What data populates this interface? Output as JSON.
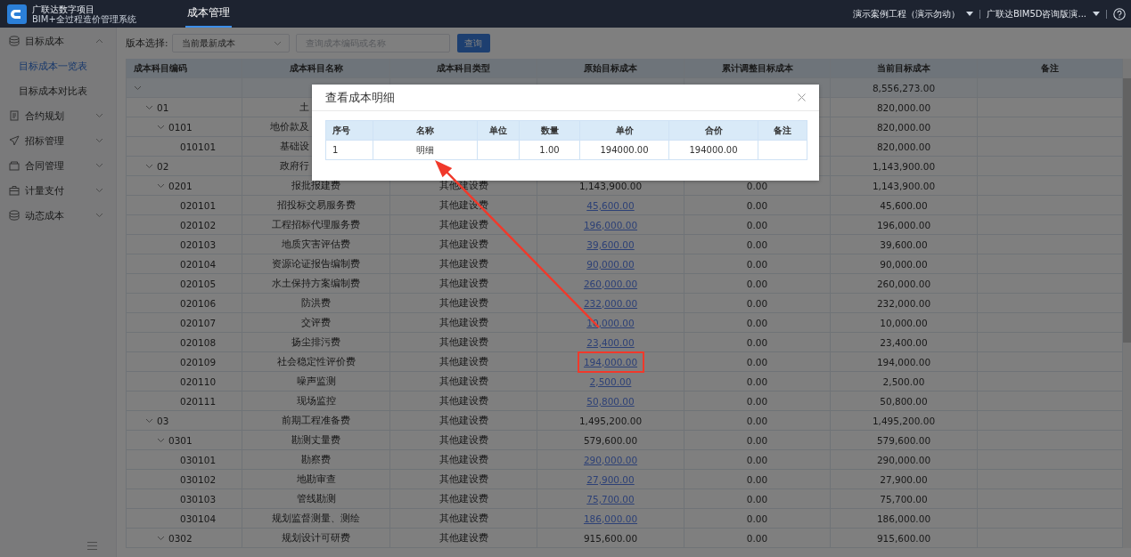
{
  "header": {
    "logo_title": "广联达数字项目",
    "logo_subtitle": "BIM+全过程造价管理系统",
    "tabs": [
      {
        "label": "成本管理",
        "selected": true
      }
    ],
    "project": "演示案例工程（演示勿动）",
    "account": "广联达BIM5D咨询版演..."
  },
  "sidebar": {
    "items": [
      {
        "label": "目标成本",
        "expanded": true,
        "children": [
          {
            "label": "目标成本一览表",
            "selected": true
          },
          {
            "label": "目标成本对比表",
            "selected": false
          }
        ]
      },
      {
        "label": "合约规划",
        "expanded": false
      },
      {
        "label": "招标管理",
        "expanded": false
      },
      {
        "label": "合同管理",
        "expanded": false
      },
      {
        "label": "计量支付",
        "expanded": false
      },
      {
        "label": "动态成本",
        "expanded": false
      }
    ]
  },
  "toolbar": {
    "version_label": "版本选择:",
    "version_value": "当前最新成本",
    "search_placeholder": "查询成本编码或名称",
    "query_button": "查询"
  },
  "table": {
    "columns": [
      "成本科目编码",
      "成本科目名称",
      "成本科目类型",
      "原始目标成本",
      "累计调整目标成本",
      "当前目标成本",
      "备注"
    ],
    "rows": [
      {
        "expanded": true,
        "current": "8,556,273.00",
        "children": [
          {
            "code": "01",
            "expanded": true,
            "name": "土",
            "current": "820,000.00",
            "children": [
              {
                "code": "0101",
                "expanded": true,
                "name": "地价款及",
                "current": "820,000.00",
                "children": [
                  {
                    "code": "010101",
                    "name": "基础设",
                    "current": "820,000.00"
                  }
                ]
              }
            ]
          },
          {
            "code": "02",
            "expanded": true,
            "name": "政府行",
            "current": "1,143,900.00",
            "children": [
              {
                "code": "0201",
                "expanded": true,
                "name": "报批报建费",
                "type": "其他建设费",
                "original": "1,143,900.00",
                "cumulative": "0.00",
                "current": "1,143,900.00",
                "children": [
                  {
                    "code": "020101",
                    "name": "招投标交易服务费",
                    "type": "其他建设费",
                    "original": "45,600.00",
                    "cumulative": "0.00",
                    "current": "45,600.00"
                  },
                  {
                    "code": "020102",
                    "name": "工程招标代理服务费",
                    "type": "其他建设费",
                    "original": "196,000.00",
                    "cumulative": "0.00",
                    "current": "196,000.00"
                  },
                  {
                    "code": "020103",
                    "name": "地质灾害评估费",
                    "type": "其他建设费",
                    "original": "39,600.00",
                    "cumulative": "0.00",
                    "current": "39,600.00"
                  },
                  {
                    "code": "020104",
                    "name": "资源论证报告编制费",
                    "type": "其他建设费",
                    "original": "90,000.00",
                    "cumulative": "0.00",
                    "current": "90,000.00"
                  },
                  {
                    "code": "020105",
                    "name": "水土保持方案编制费",
                    "type": "其他建设费",
                    "original": "260,000.00",
                    "cumulative": "0.00",
                    "current": "260,000.00"
                  },
                  {
                    "code": "020106",
                    "name": "防洪费",
                    "type": "其他建设费",
                    "original": "232,000.00",
                    "cumulative": "0.00",
                    "current": "232,000.00"
                  },
                  {
                    "code": "020107",
                    "name": "交评费",
                    "type": "其他建设费",
                    "original": "10,000.00",
                    "cumulative": "0.00",
                    "current": "10,000.00"
                  },
                  {
                    "code": "020108",
                    "name": "扬尘排污费",
                    "type": "其他建设费",
                    "original": "23,400.00",
                    "cumulative": "0.00",
                    "current": "23,400.00"
                  },
                  {
                    "code": "020109",
                    "name": "社会稳定性评价费",
                    "type": "其他建设费",
                    "original": "194,000.00",
                    "cumulative": "0.00",
                    "current": "194,000.00",
                    "highlighted": true
                  },
                  {
                    "code": "020110",
                    "name": "噪声监测",
                    "type": "其他建设费",
                    "original": "2,500.00",
                    "cumulative": "0.00",
                    "current": "2,500.00"
                  },
                  {
                    "code": "020111",
                    "name": "现场监控",
                    "type": "其他建设费",
                    "original": "50,800.00",
                    "cumulative": "0.00",
                    "current": "50,800.00"
                  }
                ]
              }
            ]
          },
          {
            "code": "03",
            "expanded": true,
            "name": "前期工程准备费",
            "type": "其他建设费",
            "original": "1,495,200.00",
            "cumulative": "0.00",
            "current": "1,495,200.00",
            "children": [
              {
                "code": "0301",
                "expanded": true,
                "name": "勘测丈量费",
                "type": "其他建设费",
                "original": "579,600.00",
                "cumulative": "0.00",
                "current": "579,600.00",
                "children": [
                  {
                    "code": "030101",
                    "name": "勘察费",
                    "type": "其他建设费",
                    "original": "290,000.00",
                    "cumulative": "0.00",
                    "current": "290,000.00"
                  },
                  {
                    "code": "030102",
                    "name": "地勘审查",
                    "type": "其他建设费",
                    "original": "27,900.00",
                    "cumulative": "0.00",
                    "current": "27,900.00"
                  },
                  {
                    "code": "030103",
                    "name": "管线勘测",
                    "type": "其他建设费",
                    "original": "75,700.00",
                    "cumulative": "0.00",
                    "current": "75,700.00"
                  },
                  {
                    "code": "030104",
                    "name": "规划监督测量、测绘",
                    "type": "其他建设费",
                    "original": "186,000.00",
                    "cumulative": "0.00",
                    "current": "186,000.00"
                  }
                ]
              },
              {
                "code": "0302",
                "expanded": true,
                "name": "规划设计可研费",
                "type": "其他建设费",
                "original": "915,600.00",
                "cumulative": "0.00",
                "current": "915,600.00"
              }
            ]
          }
        ]
      }
    ]
  },
  "dialog": {
    "title": "查看成本明细",
    "columns": [
      "序号",
      "名称",
      "单位",
      "数量",
      "单价",
      "合价",
      "备注"
    ],
    "rows": [
      {
        "index": "1",
        "name": "明细",
        "quantity": "1.00",
        "unit_price": "194000.00",
        "total": "194000.00"
      }
    ]
  }
}
